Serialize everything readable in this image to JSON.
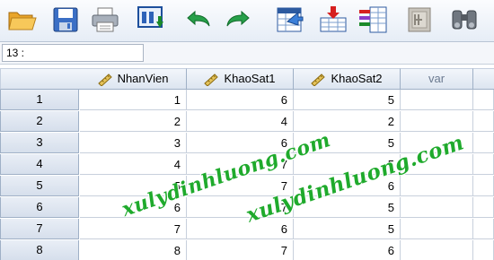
{
  "toolbar": {
    "buttons": [
      {
        "icon": "open-folder-icon"
      },
      {
        "icon": "save-icon"
      },
      {
        "icon": "print-icon"
      },
      {
        "icon": "recall-dialog-icon"
      },
      {
        "icon": "undo-icon"
      },
      {
        "icon": "redo-icon"
      },
      {
        "icon": "goto-case-icon"
      },
      {
        "icon": "insert-cases-icon"
      },
      {
        "icon": "variables-icon"
      },
      {
        "icon": "split-file-icon"
      },
      {
        "icon": "find-icon"
      }
    ]
  },
  "cell_reference": {
    "value": "13 :"
  },
  "grid": {
    "columns": [
      "NhanVien",
      "KhaoSat1",
      "KhaoSat2",
      "var"
    ],
    "rows": [
      {
        "num": "1",
        "values": [
          "1",
          "6",
          "5",
          ""
        ]
      },
      {
        "num": "2",
        "values": [
          "2",
          "4",
          "2",
          ""
        ]
      },
      {
        "num": "3",
        "values": [
          "3",
          "6",
          "5",
          ""
        ]
      },
      {
        "num": "4",
        "values": [
          "4",
          "7",
          "5",
          ""
        ]
      },
      {
        "num": "5",
        "values": [
          "5",
          "7",
          "6",
          ""
        ]
      },
      {
        "num": "6",
        "values": [
          "6",
          "7",
          "5",
          ""
        ]
      },
      {
        "num": "7",
        "values": [
          "7",
          "6",
          "5",
          ""
        ]
      },
      {
        "num": "8",
        "values": [
          "8",
          "7",
          "6",
          ""
        ]
      }
    ]
  },
  "watermark": {
    "text": "xulydinhluong.com"
  },
  "colors": {
    "watermark": "#1faa2c",
    "header_bg": "#dde5f0",
    "grid_line": "#c8d0dc"
  }
}
